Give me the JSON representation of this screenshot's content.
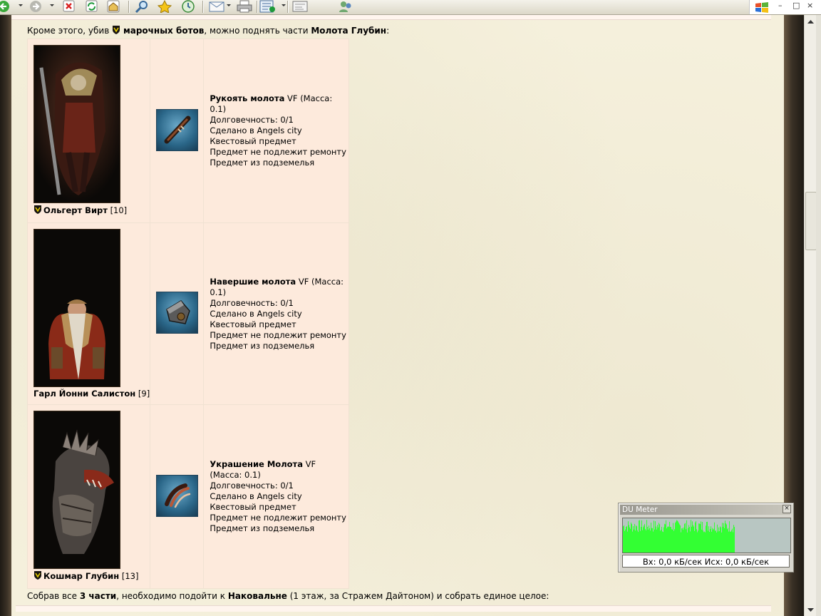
{
  "toolbar": {
    "buttons": [
      {
        "name": "back-button",
        "icon": "arrow-left-icon"
      },
      {
        "name": "forward-button",
        "icon": "arrow-right-icon"
      },
      {
        "name": "stop-button",
        "icon": "stop-icon"
      },
      {
        "name": "refresh-button",
        "icon": "refresh-icon"
      },
      {
        "name": "home-button",
        "icon": "home-icon"
      },
      {
        "name": "search-button",
        "icon": "search-icon"
      },
      {
        "name": "favorites-button",
        "icon": "star-icon"
      },
      {
        "name": "history-button",
        "icon": "history-icon"
      },
      {
        "name": "mail-button",
        "icon": "mail-icon"
      },
      {
        "name": "print-button",
        "icon": "printer-icon"
      },
      {
        "name": "messenger-button",
        "icon": "messenger-icon"
      },
      {
        "name": "edit-button",
        "icon": "edit-icon"
      },
      {
        "name": "contacts-button",
        "icon": "people-icon"
      }
    ],
    "window_controls": {
      "minimize": "–",
      "maximize": "□",
      "close": "×"
    }
  },
  "content": {
    "intro": {
      "text1": "Кроме этого, убив ",
      "bold1": "марочных ботов",
      "text2": ", можно поднять части ",
      "bold2": "Молота Глубин",
      "text3": ":"
    },
    "rows": [
      {
        "boss_name": "Ольгерт Вирт",
        "boss_level": "[10]",
        "badge": true,
        "portrait": "knight-portrait",
        "item_icon": "hammer-handle-icon",
        "item_name": "Рукоять молота",
        "item_suffix": "VF",
        "item_mass": "(Масса: 0.1)",
        "lines": [
          "Долговечность: 0/1",
          "Сделано в Angels city",
          "Квестовый предмет",
          "Предмет не подлежит ремонту",
          "Предмет из подземелья"
        ]
      },
      {
        "boss_name": "Гарл Йонни Салистон",
        "boss_level": "[9]",
        "badge": false,
        "portrait": "dwarf-portrait",
        "item_icon": "hammer-head-icon",
        "item_name": "Навершие молота",
        "item_suffix": "VF",
        "item_mass": "(Масса: 0.1)",
        "lines": [
          "Долговечность: 0/1",
          "Сделано в Angels city",
          "Квестовый предмет",
          "Предмет не подлежит ремонту",
          "Предмет из подземелья"
        ]
      },
      {
        "boss_name": "Кошмар Глубин",
        "boss_level": "[13]",
        "badge": true,
        "portrait": "monster-portrait",
        "item_icon": "hammer-ornament-icon",
        "item_name": "Украшение Молота",
        "item_suffix": "VF",
        "item_mass": "(Масса: 0.1)",
        "lines": [
          "Долговечность: 0/1",
          "Сделано в Angels city",
          "Квестовый предмет",
          "Предмет не подлежит ремонту",
          "Предмет из подземелья"
        ]
      }
    ],
    "outro": {
      "text1": "Собрав все ",
      "bold1": "3 части",
      "text2": ", необходимо подойти к ",
      "bold2": "Наковальне",
      "text3": " (1 этаж, за Стражем Дайтоном) и собрать единое целое:"
    }
  },
  "du_meter": {
    "title": "DU Meter",
    "close": "×",
    "readout": "Вх: 0,0 кБ/сек  Исх: 0,0 кБ/сек",
    "graph_color": "#33ff33",
    "graph_bg": "#b8c6c2"
  }
}
